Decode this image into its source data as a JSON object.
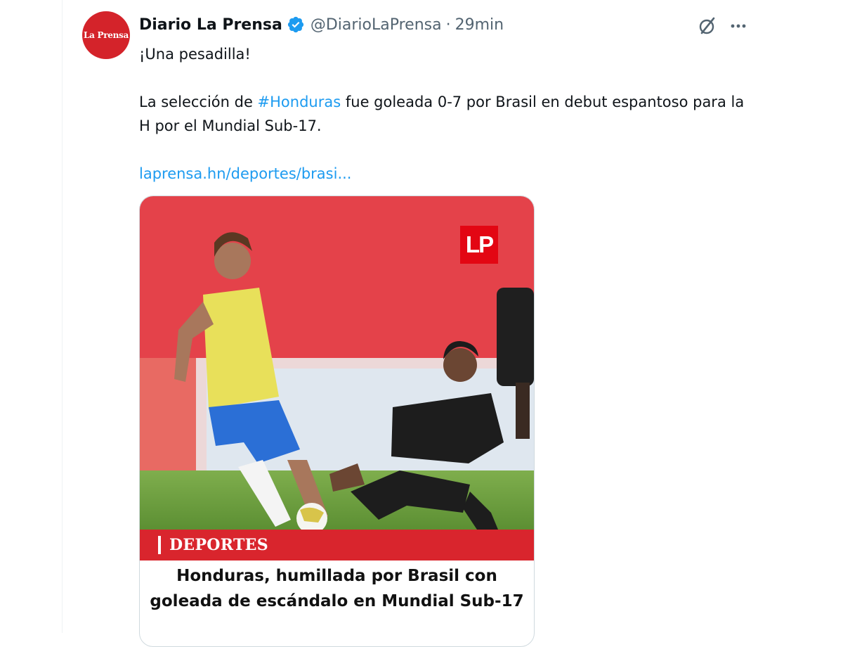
{
  "tweet": {
    "avatar_text": "La Prensa",
    "author_name": "Diario La Prensa",
    "handle": "@DiarioLaPrensa",
    "separator": "·",
    "time": "29min",
    "text_intro": "¡Una pesadilla!",
    "text_body_prefix": "La selección de ",
    "hashtag": "#Honduras",
    "text_body_suffix": " fue goleada 0-7 por Brasil en debut espantoso para la H por el Mundial Sub-17.",
    "link": "laprensa.hn/deportes/brasi..."
  },
  "card": {
    "logo_text": "LP",
    "section": "DEPORTES",
    "headline_line1": "Honduras, humillada por Brasil con",
    "headline_line2": "goleada de escándalo en Mundial Sub-17"
  },
  "icons": {
    "verified": "verified-badge-icon",
    "grok": "grok-icon",
    "more": "more-options-icon"
  },
  "colors": {
    "accent_link": "#1d9bf0",
    "brand_red": "#d4232a",
    "secondary_text": "#536471"
  }
}
